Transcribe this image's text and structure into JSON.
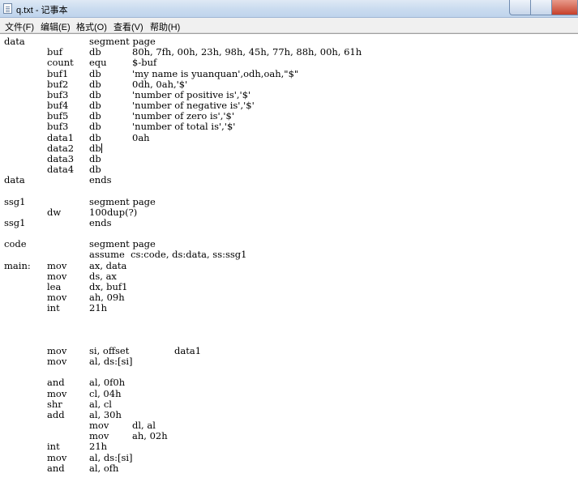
{
  "window": {
    "title": "q.txt - 记事本"
  },
  "menu": {
    "file": "文件(F)",
    "edit": "编辑(E)",
    "format": "格式(O)",
    "view": "查看(V)",
    "help": "帮助(H)"
  },
  "lines": [
    [
      "data",
      "",
      "segment page"
    ],
    [
      "",
      "buf",
      "db",
      "80h, 7fh, 00h, 23h, 98h, 45h, 77h, 88h, 00h, 61h"
    ],
    [
      "",
      "count",
      "equ",
      "$-buf"
    ],
    [
      "",
      "buf1",
      "db",
      "'my name is yuanquan',odh,oah,\"$\""
    ],
    [
      "",
      "buf2",
      "db",
      "0dh, 0ah,'$'"
    ],
    [
      "",
      "buf3",
      "db",
      "'number of positive is','$'"
    ],
    [
      "",
      "buf4",
      "db",
      "'number of negative is','$'"
    ],
    [
      "",
      "buf5",
      "db",
      "'number of zero is','$'"
    ],
    [
      "",
      "buf3",
      "db",
      "'number of total is','$'"
    ],
    [
      "",
      "data1",
      "db",
      "0ah"
    ],
    [
      "",
      "data2",
      "db"
    ],
    [
      "",
      "data3",
      "db"
    ],
    [
      "",
      "data4",
      "db"
    ],
    [
      "data",
      "",
      "ends"
    ],
    [],
    [
      "ssg1",
      "",
      "segment page"
    ],
    [
      "",
      "dw",
      "100dup(?)"
    ],
    [
      "ssg1",
      "",
      "ends"
    ],
    [],
    [
      "code",
      "",
      "segment page"
    ],
    [
      "",
      "",
      "assume  cs:code, ds:data, ss:ssg1"
    ],
    [
      "main:",
      "mov",
      "ax, data"
    ],
    [
      "",
      "mov",
      "ds, ax"
    ],
    [
      "",
      "lea",
      "dx, buf1"
    ],
    [
      "",
      "mov",
      "ah, 09h"
    ],
    [
      "",
      "int",
      "21h"
    ],
    [],
    [],
    [],
    [
      "",
      "mov",
      "si, offset",
      "",
      "data1"
    ],
    [
      "",
      "mov",
      "al, ds:[si]"
    ],
    [],
    [
      "",
      "and",
      "al, 0f0h"
    ],
    [
      "",
      "mov",
      "cl, 04h"
    ],
    [
      "",
      "shr",
      "al, cl"
    ],
    [
      "",
      "add",
      "al, 30h"
    ],
    [
      "",
      "",
      "mov",
      "dl, al"
    ],
    [
      "",
      "",
      "mov",
      "ah, 02h"
    ],
    [
      "",
      "int",
      "21h"
    ],
    [
      "",
      "mov",
      "al, ds:[si]"
    ],
    [
      "",
      "and",
      "al, ofh"
    ]
  ],
  "caret": {
    "line": 10
  }
}
